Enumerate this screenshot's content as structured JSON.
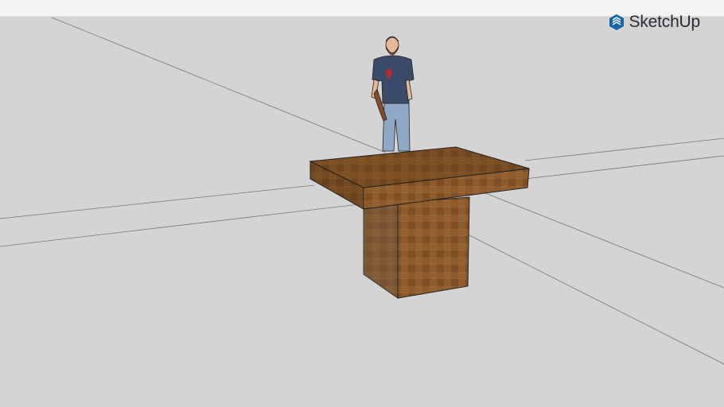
{
  "brand": {
    "name": "SketchUp",
    "color": "#005f9e"
  },
  "scene": {
    "background": "#d4d4d4",
    "wood_color": "#8a5a2b"
  }
}
